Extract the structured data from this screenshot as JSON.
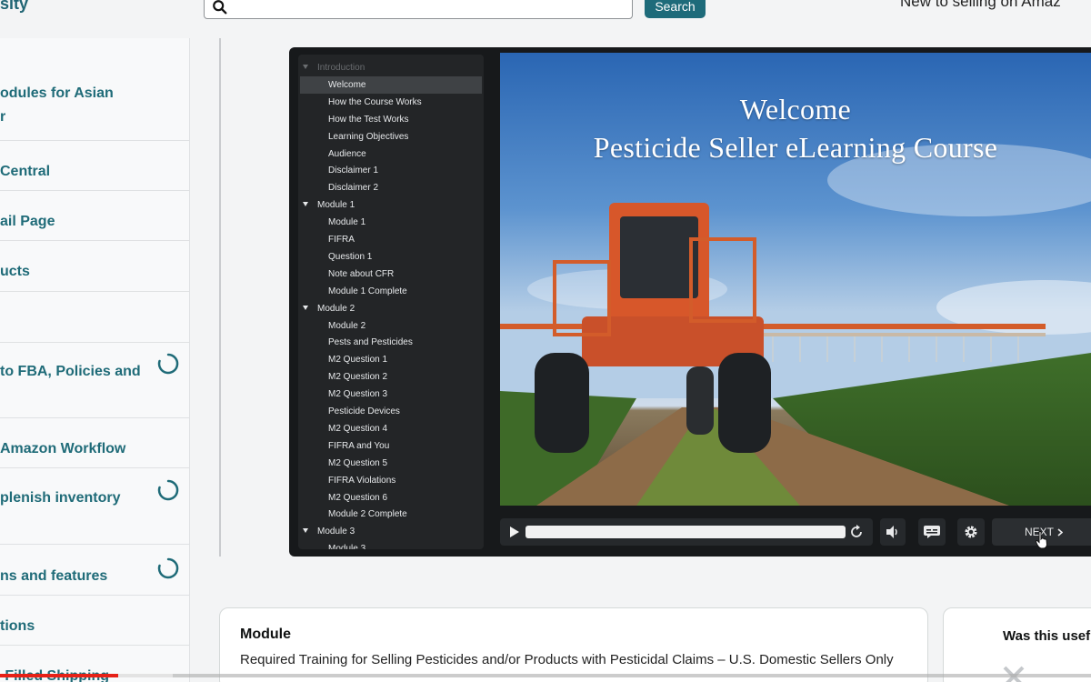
{
  "header": {
    "logo_fragment": "sity",
    "search_button": "Search",
    "right_link": "New to selling on Amaz"
  },
  "sidebar": {
    "items": [
      {
        "label": "odules for Asian\nr",
        "loading": false
      },
      {
        "label": " Central",
        "loading": false
      },
      {
        "label": "ail Page",
        "loading": false
      },
      {
        "label": "ucts",
        "loading": false
      },
      {
        "label": "",
        "loading": false
      },
      {
        "label": " to FBA, Policies and",
        "loading": true
      },
      {
        "label": " Amazon Workflow",
        "loading": false
      },
      {
        "label": "plenish inventory",
        "loading": true
      },
      {
        "label": "ns and features",
        "loading": true
      },
      {
        "label": "tions",
        "loading": false
      },
      {
        "label": "-Filled Shipping",
        "loading": false
      }
    ]
  },
  "player": {
    "outline": [
      {
        "label": "Introduction",
        "kind": "section",
        "dim": true
      },
      {
        "label": "Welcome",
        "kind": "item",
        "active": true
      },
      {
        "label": "How the Course Works",
        "kind": "item"
      },
      {
        "label": "How the Test Works",
        "kind": "item"
      },
      {
        "label": "Learning Objectives",
        "kind": "item"
      },
      {
        "label": "Audience",
        "kind": "item"
      },
      {
        "label": "Disclaimer 1",
        "kind": "item"
      },
      {
        "label": "Disclaimer 2",
        "kind": "item"
      },
      {
        "label": "Module 1",
        "kind": "section"
      },
      {
        "label": "Module 1",
        "kind": "item"
      },
      {
        "label": "FIFRA",
        "kind": "item"
      },
      {
        "label": "Question 1",
        "kind": "item"
      },
      {
        "label": "Note about CFR",
        "kind": "item"
      },
      {
        "label": "Module 1 Complete",
        "kind": "item"
      },
      {
        "label": "Module 2",
        "kind": "section"
      },
      {
        "label": "Module 2",
        "kind": "item"
      },
      {
        "label": "Pests and Pesticides",
        "kind": "item"
      },
      {
        "label": "M2 Question 1",
        "kind": "item"
      },
      {
        "label": "M2 Question 2",
        "kind": "item"
      },
      {
        "label": "M2 Question 3",
        "kind": "item"
      },
      {
        "label": "Pesticide Devices",
        "kind": "item"
      },
      {
        "label": "M2 Question 4",
        "kind": "item"
      },
      {
        "label": "FIFRA and You",
        "kind": "item"
      },
      {
        "label": "M2 Question 5",
        "kind": "item"
      },
      {
        "label": "FIFRA Violations",
        "kind": "item"
      },
      {
        "label": "M2 Question 6",
        "kind": "item"
      },
      {
        "label": "Module 2 Complete",
        "kind": "item"
      },
      {
        "label": "Module 3",
        "kind": "section"
      },
      {
        "label": "Module 3",
        "kind": "item"
      }
    ],
    "slide_title_line1": "Welcome",
    "slide_title_line2": "Pesticide Seller eLearning Course",
    "progress_fraction": 1.0,
    "next_label": "NEXT"
  },
  "module_card": {
    "heading": "Module",
    "description": "Required Training for Selling Pesticides and/or Products with Pesticidal Claims – U.S. Domestic Sellers Only"
  },
  "feedback_card": {
    "label": "Was this usef"
  },
  "video": {
    "played_fraction": 0.108,
    "buffered_fraction": 0.158
  },
  "colors": {
    "accent_teal": "#1f6b78",
    "search_button": "#1e6b7a",
    "video_progress": "#e62117"
  }
}
